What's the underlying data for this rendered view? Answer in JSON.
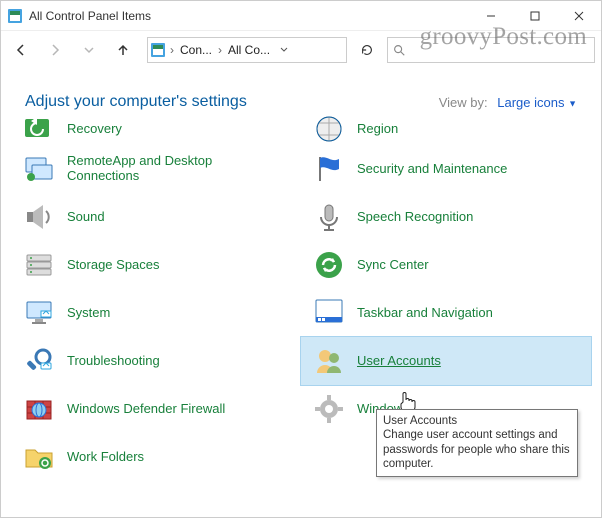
{
  "window": {
    "title": "All Control Panel Items"
  },
  "breadcrumb": {
    "root": "Con...",
    "current": "All Co..."
  },
  "search": {
    "placeholder": ""
  },
  "header": {
    "title": "Adjust your computer's settings",
    "viewby_label": "View by:",
    "viewby_value": "Large icons"
  },
  "items": {
    "left": [
      {
        "label": "Recovery"
      },
      {
        "label": "RemoteApp and Desktop Connections"
      },
      {
        "label": "Sound"
      },
      {
        "label": "Storage Spaces"
      },
      {
        "label": "System"
      },
      {
        "label": "Troubleshooting"
      },
      {
        "label": "Windows Defender Firewall"
      },
      {
        "label": "Work Folders"
      }
    ],
    "right": [
      {
        "label": "Region"
      },
      {
        "label": "Security and Maintenance"
      },
      {
        "label": "Speech Recognition"
      },
      {
        "label": "Sync Center"
      },
      {
        "label": "Taskbar and Navigation"
      },
      {
        "label": "User Accounts"
      },
      {
        "label": "Windows"
      },
      {
        "label": ""
      }
    ]
  },
  "tooltip": {
    "title": "User Accounts",
    "body": "Change user account settings and passwords for people who share this computer."
  },
  "watermark": "groovyPost.com"
}
